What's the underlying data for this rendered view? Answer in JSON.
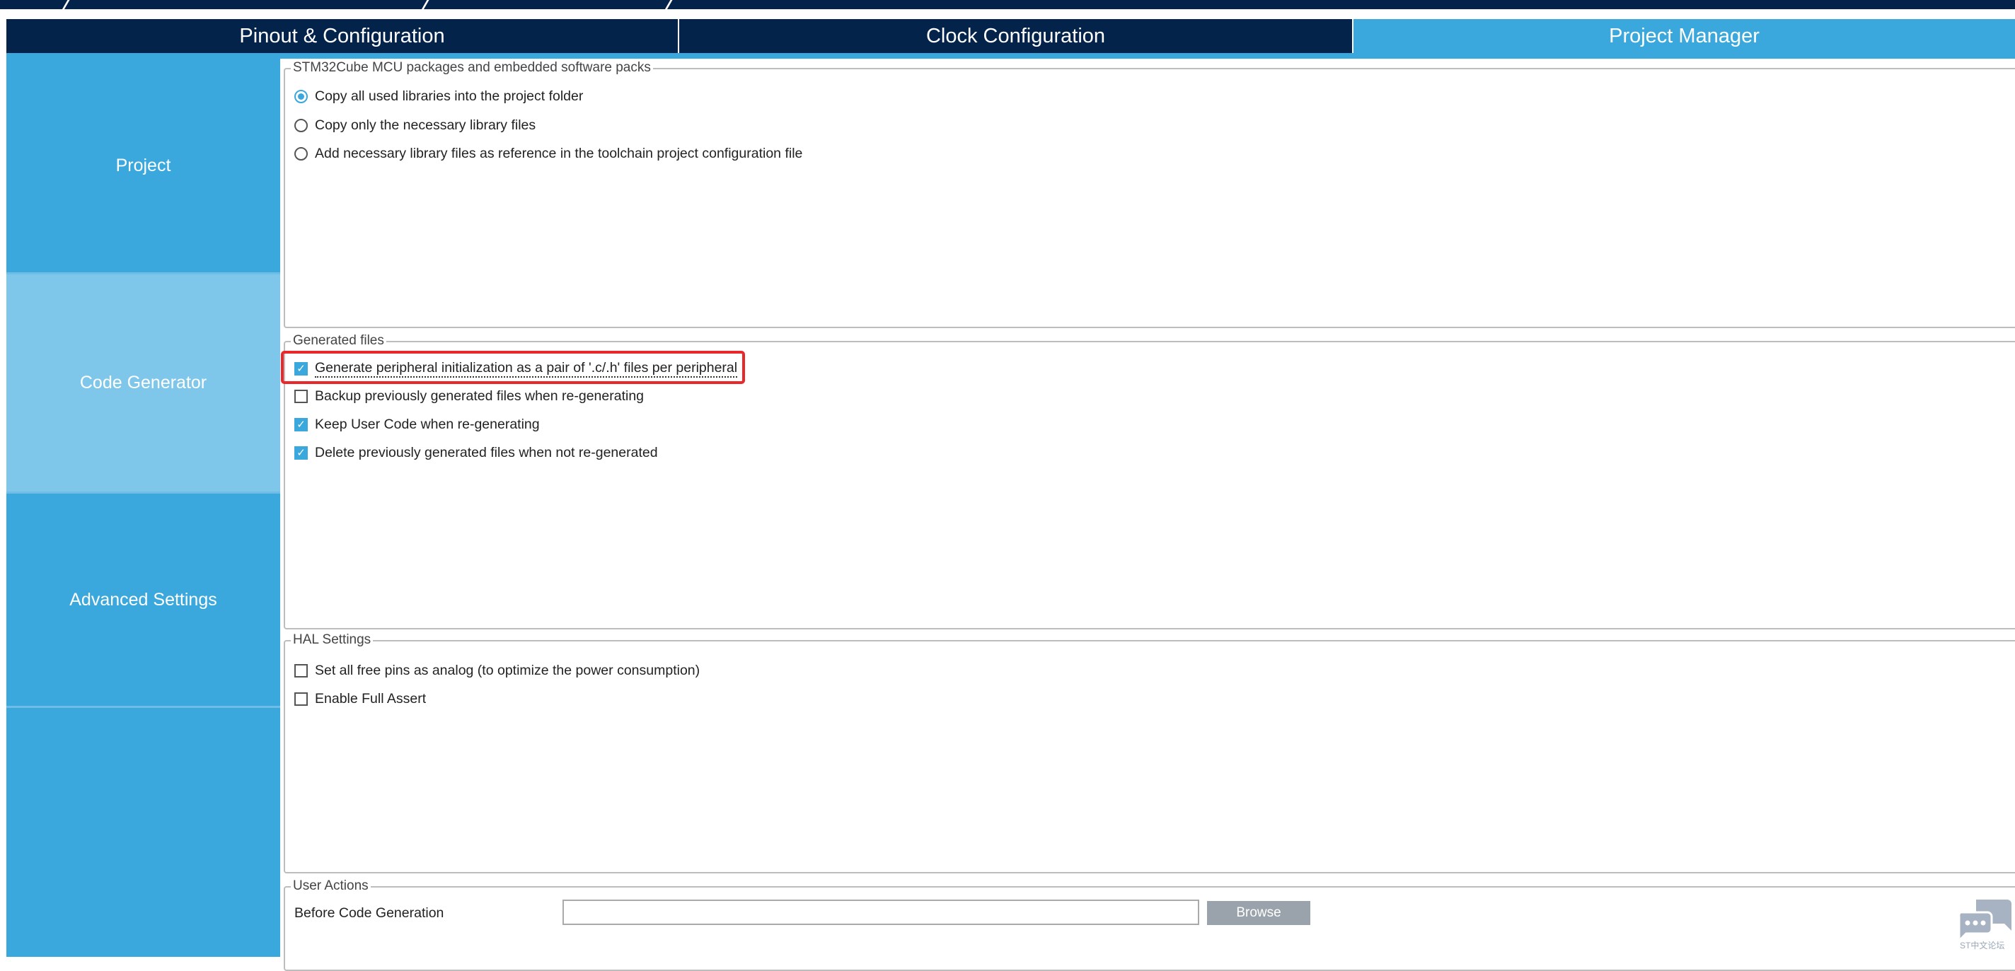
{
  "tabs": [
    {
      "label": "Pinout & Configuration"
    },
    {
      "label": "Clock Configuration"
    },
    {
      "label": "Project Manager"
    }
  ],
  "sidebar": {
    "items": [
      {
        "label": "Project"
      },
      {
        "label": "Code Generator"
      },
      {
        "label": "Advanced Settings"
      }
    ]
  },
  "packs": {
    "legend": "STM32Cube MCU packages and embedded software packs",
    "options": [
      {
        "label": "Copy all used libraries into the project folder",
        "selected": true
      },
      {
        "label": "Copy only the necessary library files",
        "selected": false
      },
      {
        "label": "Add necessary library files as reference in the toolchain project configuration file",
        "selected": false
      }
    ]
  },
  "generated": {
    "legend": "Generated files",
    "options": [
      {
        "label": "Generate peripheral initialization as a pair of '.c/.h' files per peripheral",
        "checked": true
      },
      {
        "label": "Backup previously generated files when re-generating",
        "checked": false
      },
      {
        "label": "Keep User Code when re-generating",
        "checked": true
      },
      {
        "label": "Delete previously generated files when not re-generated",
        "checked": true
      }
    ]
  },
  "hal": {
    "legend": "HAL Settings",
    "options": [
      {
        "label": "Set all free pins as analog (to optimize the power consumption)",
        "checked": false
      },
      {
        "label": "Enable Full Assert",
        "checked": false
      }
    ]
  },
  "user_actions": {
    "legend": "User Actions",
    "before_label": "Before Code Generation",
    "before_value": "",
    "browse_label": "Browse"
  },
  "watermark": {
    "text": "ST中文论坛",
    "icon": "chat-bubbles-icon"
  },
  "colors": {
    "navy": "#03234b",
    "accent": "#3aa8dc",
    "active_side": "#7fc7ea",
    "highlight": "#e8282a"
  }
}
